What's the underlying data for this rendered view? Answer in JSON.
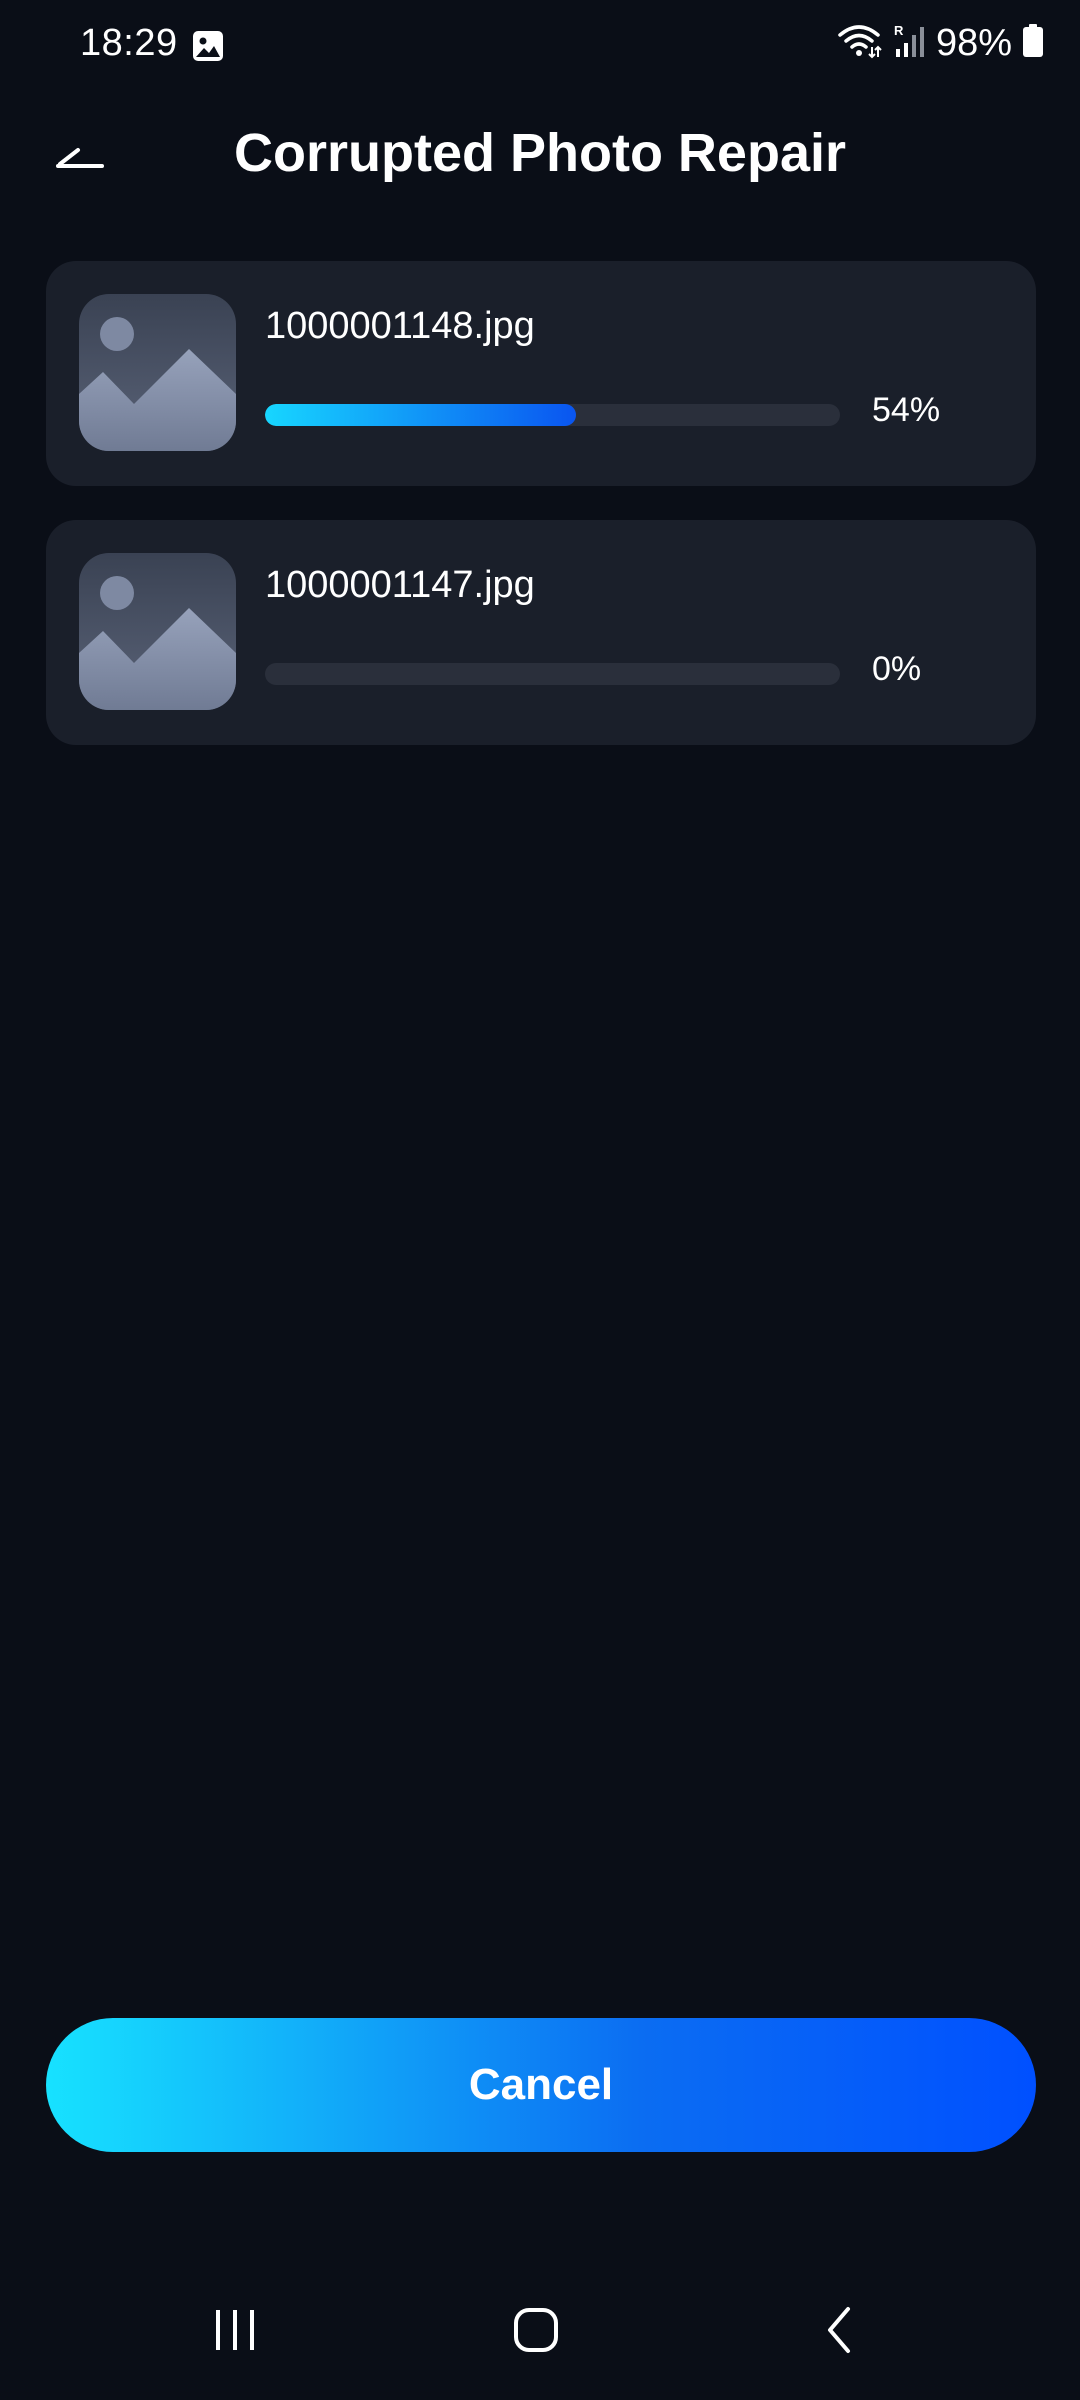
{
  "status_bar": {
    "time": "18:29",
    "battery_percent": "98%",
    "icons": [
      "gallery-icon",
      "wifi-icon",
      "signal-icon",
      "battery-icon"
    ]
  },
  "header": {
    "title": "Corrupted Photo Repair",
    "back_icon": "back-arrow-icon"
  },
  "files": [
    {
      "name": "1000001148.jpg",
      "progress": 54,
      "progress_label": "54%"
    },
    {
      "name": "1000001147.jpg",
      "progress": 0,
      "progress_label": "0%"
    }
  ],
  "actions": {
    "cancel_label": "Cancel"
  },
  "nav_bar": {
    "items": [
      "recent-apps-icon",
      "home-icon",
      "back-icon"
    ]
  },
  "colors": {
    "background": "#0a0e17",
    "card": "#1a1f2a",
    "accent_start": "#17d6ff",
    "accent_end": "#0050ff"
  }
}
